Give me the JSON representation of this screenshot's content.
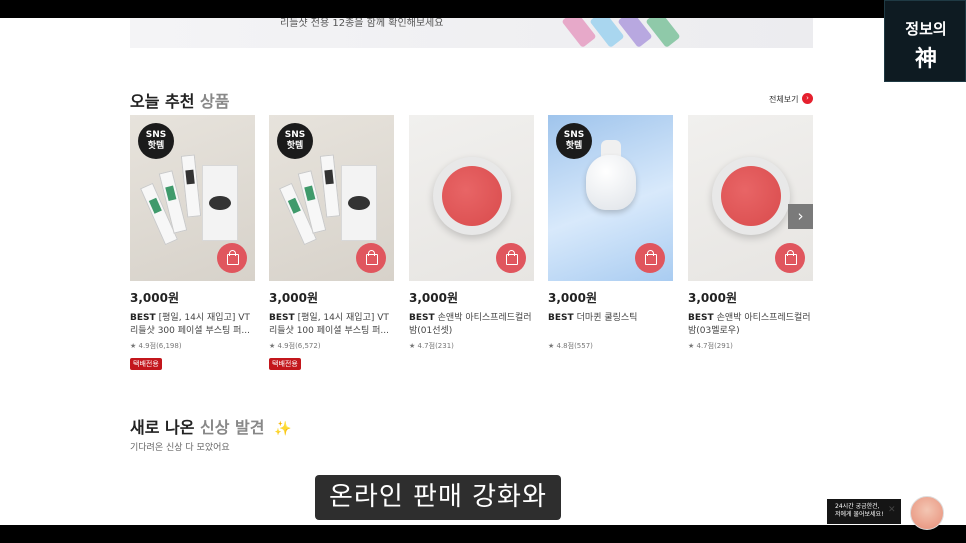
{
  "banner": {
    "text": "리들샷 전용 12종을 함께 확인해보세요",
    "stick_colors": [
      "#e7a9c9",
      "#a9d6ef",
      "#b8a8e0",
      "#8fc9a9"
    ]
  },
  "recommend": {
    "title_main": "오늘 추천",
    "title_accent": "상품",
    "view_all": "전체보기",
    "view_all_icon": "chevron-right-icon",
    "next_icon": "›",
    "products": [
      {
        "badge": "SNS 핫템",
        "price": "3,000원",
        "best": "BEST",
        "name": "[평일, 14시 재입고] VT 리들샷 300 페이셜 부스팅 퍼...",
        "rating": "★ 4.9점(6,198)",
        "tag": "택배전용",
        "image": "stick"
      },
      {
        "badge": "SNS 핫템",
        "price": "3,000원",
        "best": "BEST",
        "name": "[평일, 14시 재입고] VT 리들샷 100 페이셜 부스팅 퍼...",
        "rating": "★ 4.9점(6,572)",
        "tag": "택배전용",
        "image": "stick"
      },
      {
        "badge": "",
        "price": "3,000원",
        "best": "BEST",
        "name": "손앤박 아티스프레드컬러밤(01선셋)",
        "rating": "★ 4.7점(231)",
        "tag": "",
        "image": "balm"
      },
      {
        "badge": "SNS 핫템",
        "price": "3,000원",
        "best": "BEST",
        "name": "더마퀸 쿨링스틱",
        "rating": "★ 4.8점(557)",
        "tag": "",
        "image": "ice"
      },
      {
        "badge": "",
        "price": "3,000원",
        "best": "BEST",
        "name": "손앤박 아티스프레드컬러밤(03멜로우)",
        "rating": "★ 4.7점(291)",
        "tag": "",
        "image": "balm"
      }
    ]
  },
  "new_arrivals": {
    "title_main": "새로 나온",
    "title_accent": "신상 발견",
    "sparkle": "✨",
    "subtitle": "기다려온 신상 다 모았어요"
  },
  "video_subtitle": "온라인 판매 강화와",
  "chat": {
    "line1": "24시간 궁금한건,",
    "line2": "저에게 물어보세요!",
    "close": "✕"
  },
  "logo": {
    "top": "정보의",
    "bottom": "神"
  }
}
